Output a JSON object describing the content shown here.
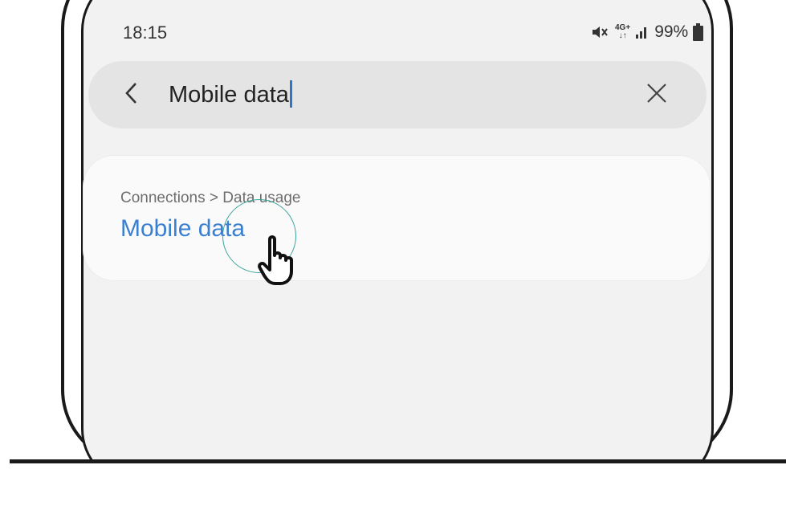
{
  "status_bar": {
    "time": "18:15",
    "network_label": "4G+",
    "battery_percent": "99%",
    "icons": [
      "mute-icon",
      "network-4g-icon",
      "signal-icon",
      "battery-icon"
    ]
  },
  "search": {
    "query": "Mobile data",
    "back_icon": "chevron-left-icon",
    "clear_icon": "close-icon"
  },
  "results": [
    {
      "path": "Connections > Data usage",
      "title": "Mobile data"
    }
  ],
  "overlay": {
    "icon": "pointer-hand-icon"
  },
  "colors": {
    "accent": "#3b7fd1",
    "caret": "#2a78c5",
    "tap_ring": "#3aa59a",
    "screen_bg": "#f2f2f2"
  }
}
